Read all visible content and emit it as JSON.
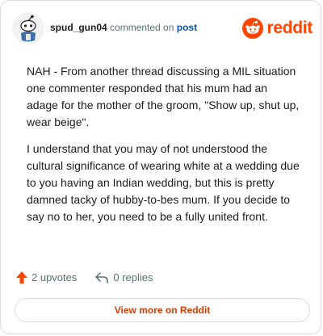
{
  "header": {
    "username": "spud_gun04",
    "action_text": "commented on",
    "post_link": "post",
    "brand_name": "reddit"
  },
  "comment": {
    "paragraphs": [
      "NAH - From another thread discussing a MIL situation one commenter responded that his mum had an adage for the mother of the groom, \"Show up, shut up, wear beige\".",
      "I understand that you may of not understood the cultural significance of wearing white at a wedding due to you having an Indian wedding, but this is pretty damned tacky of hubby-to-bes mum. If you decide to say no to her, you need to be a fully united front."
    ]
  },
  "actions": {
    "upvotes_label": "2 upvotes",
    "replies_label": "0 replies"
  },
  "footer": {
    "view_more_label": "View more on Reddit"
  },
  "colors": {
    "brand_orange": "#ff4500",
    "upvote_color": "#ff4500",
    "link_blue": "#0a4fb1",
    "muted_text": "#576f76",
    "view_more_text": "#d93a00"
  },
  "icons": {
    "avatar": "snoo-avatar-icon",
    "brand": "reddit-logo-icon",
    "upvote": "upvote-arrow-icon",
    "reply": "reply-arrow-icon"
  }
}
